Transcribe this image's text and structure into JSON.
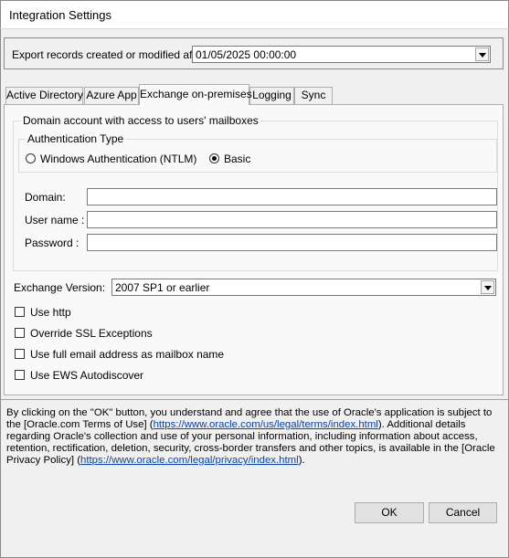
{
  "window": {
    "title": "Integration Settings"
  },
  "export": {
    "label": "Export records created or modified after",
    "value": "01/05/2025 00:00:00"
  },
  "tabs": [
    {
      "label": "Active Directory"
    },
    {
      "label": "Azure App"
    },
    {
      "label": "Exchange on-premises"
    },
    {
      "label": "Logging"
    },
    {
      "label": "Sync"
    }
  ],
  "exchange": {
    "domain_group": "Domain account with access to users' mailboxes",
    "auth_group": "Authentication Type",
    "auth_ntlm": "Windows Authentication (NTLM)",
    "auth_basic": "Basic",
    "domain_label": "Domain:",
    "username_label": "User name :",
    "password_label": "Password :",
    "domain_value": "",
    "username_value": "",
    "password_value": "",
    "version_label": "Exchange Version:",
    "version_value": "2007 SP1 or earlier",
    "checkboxes": [
      {
        "label": "Use http"
      },
      {
        "label": "Override SSL Exceptions"
      },
      {
        "label": "Use full email address as mailbox name"
      },
      {
        "label": "Use EWS Autodiscover"
      }
    ]
  },
  "disclaimer": {
    "p1": "By clicking on the \"OK\" button, you understand and agree that the use of Oracle's application is subject to the [Oracle.com Terms of Use] (",
    "link1": "https://www.oracle.com/us/legal/terms/index.html",
    "p2": "). Additional details regarding Oracle's collection and use of your personal information, including information about access, retention, rectification, deletion, security, cross-border transfers and other topics, is available in the [Oracle Privacy Policy] (",
    "link2": "https://www.oracle.com/legal/privacy/index.html",
    "p3": ")."
  },
  "buttons": {
    "ok": "OK",
    "cancel": "Cancel"
  }
}
